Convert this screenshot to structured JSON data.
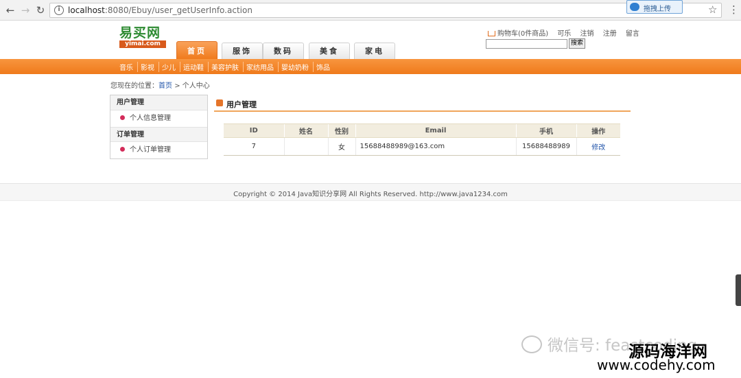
{
  "browser": {
    "url_host": "localhost",
    "url_port_path": ":8080/Ebuy/user_getUserInfo.action",
    "upload_label": "拖拽上传"
  },
  "site": {
    "logo_cn": "易买网",
    "logo_en": "yimai.com",
    "top_links": {
      "cart": "购物车(0件商品)",
      "user": "可乐",
      "logout": "注销",
      "register": "注册",
      "message": "留言"
    },
    "search_button": "搜索",
    "tabs": [
      "首页",
      "服饰",
      "数码",
      "美食",
      "家电"
    ],
    "categories": [
      "音乐",
      "影视",
      "少儿",
      "运动鞋",
      "美容护肤",
      "家纺用品",
      "婴幼奶粉",
      "饰品"
    ]
  },
  "breadcrumb": {
    "prefix": "您现在的位置：",
    "home": "首页",
    "sep": ">",
    "current": "个人中心"
  },
  "sidebar": {
    "group1_title": "用户管理",
    "group1_item": "个人信息管理",
    "group2_title": "订单管理",
    "group2_item": "个人订单管理"
  },
  "panel": {
    "title": "用户管理",
    "columns": [
      "ID",
      "姓名",
      "性别",
      "Email",
      "手机",
      "操作"
    ],
    "rows": [
      {
        "id": "7",
        "name": "",
        "gender": "女",
        "email": "15688488989@163.com",
        "phone": "15688488989",
        "action": "修改"
      }
    ]
  },
  "footer": {
    "copyright": "Copyright © 2014 Java知识分享网 All Rights Reserved. http://www.java1234.com"
  },
  "watermark": {
    "wechat": "微信号: feastcoding",
    "site_name": "源码海洋网",
    "site_url": "www.codehy.com"
  }
}
